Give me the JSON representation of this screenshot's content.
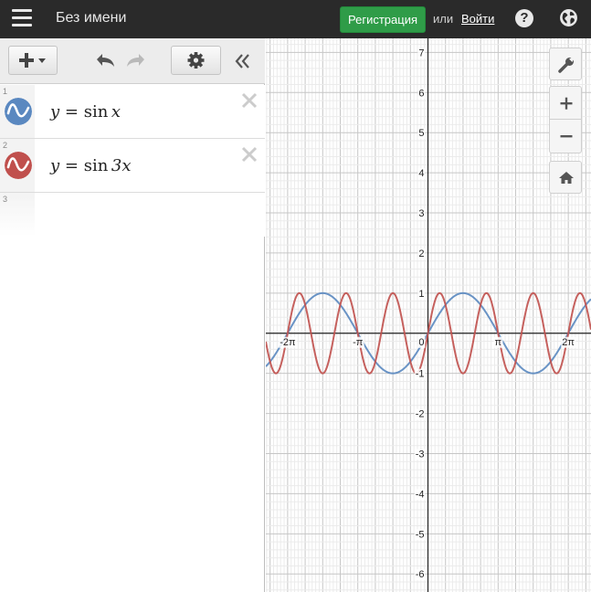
{
  "app": {
    "title": "Без имени",
    "signup_label": "Регистрация",
    "or_label": "или",
    "login_label": "Войти",
    "help_label": "?"
  },
  "colors": {
    "topbar": "#2a2a2a",
    "signup": "#2f9c48",
    "series_blue": "#5a88c0",
    "series_red": "#c0504d"
  },
  "icons": {
    "menu": "hamburger-icon",
    "help": "help-icon",
    "language": "globe-icon",
    "add": "plus-icon",
    "undo": "undo-icon",
    "redo": "redo-icon",
    "settings": "gear-icon",
    "collapse": "double-chevron-left-icon",
    "wrench": "wrench-icon",
    "zoom_in": "plus-icon",
    "zoom_out": "minus-icon",
    "home": "home-icon",
    "delete": "close-icon"
  },
  "expressions": [
    {
      "num": "1",
      "lhs": "y",
      "op": " = ",
      "fn": "sin",
      "arg": "x",
      "color": "#5a88c0"
    },
    {
      "num": "2",
      "lhs": "y",
      "op": " = ",
      "fn": "sin",
      "arg": "3x",
      "color": "#c0504d"
    },
    {
      "num": "3"
    }
  ],
  "chart_data": {
    "type": "line",
    "series": [
      {
        "name": "y = sin x",
        "function": "sin(x)",
        "color": "#5a88c0"
      },
      {
        "name": "y = sin 3x",
        "function": "sin(3x)",
        "color": "#c0504d"
      }
    ],
    "xlim": [
      -7.26,
      7.3
    ],
    "ylim": [
      -6.45,
      7.35
    ],
    "x_ticks": [
      {
        "value": -6.283185,
        "label": "-2π"
      },
      {
        "value": -3.141593,
        "label": "-π"
      },
      {
        "value": 3.141593,
        "label": "π"
      },
      {
        "value": 6.283185,
        "label": "2π"
      }
    ],
    "y_ticks": [
      {
        "value": 7,
        "label": "7"
      },
      {
        "value": 6,
        "label": "6"
      },
      {
        "value": 5,
        "label": "5"
      },
      {
        "value": 4,
        "label": "4"
      },
      {
        "value": 3,
        "label": "3"
      },
      {
        "value": 2,
        "label": "2"
      },
      {
        "value": 1,
        "label": "1"
      },
      {
        "value": -1,
        "label": "-1"
      },
      {
        "value": -2,
        "label": "-2"
      },
      {
        "value": -3,
        "label": "-3"
      },
      {
        "value": -4,
        "label": "-4"
      },
      {
        "value": -5,
        "label": "-5"
      },
      {
        "value": -6,
        "label": "-6"
      }
    ],
    "origin_label": "0",
    "grid": true
  }
}
